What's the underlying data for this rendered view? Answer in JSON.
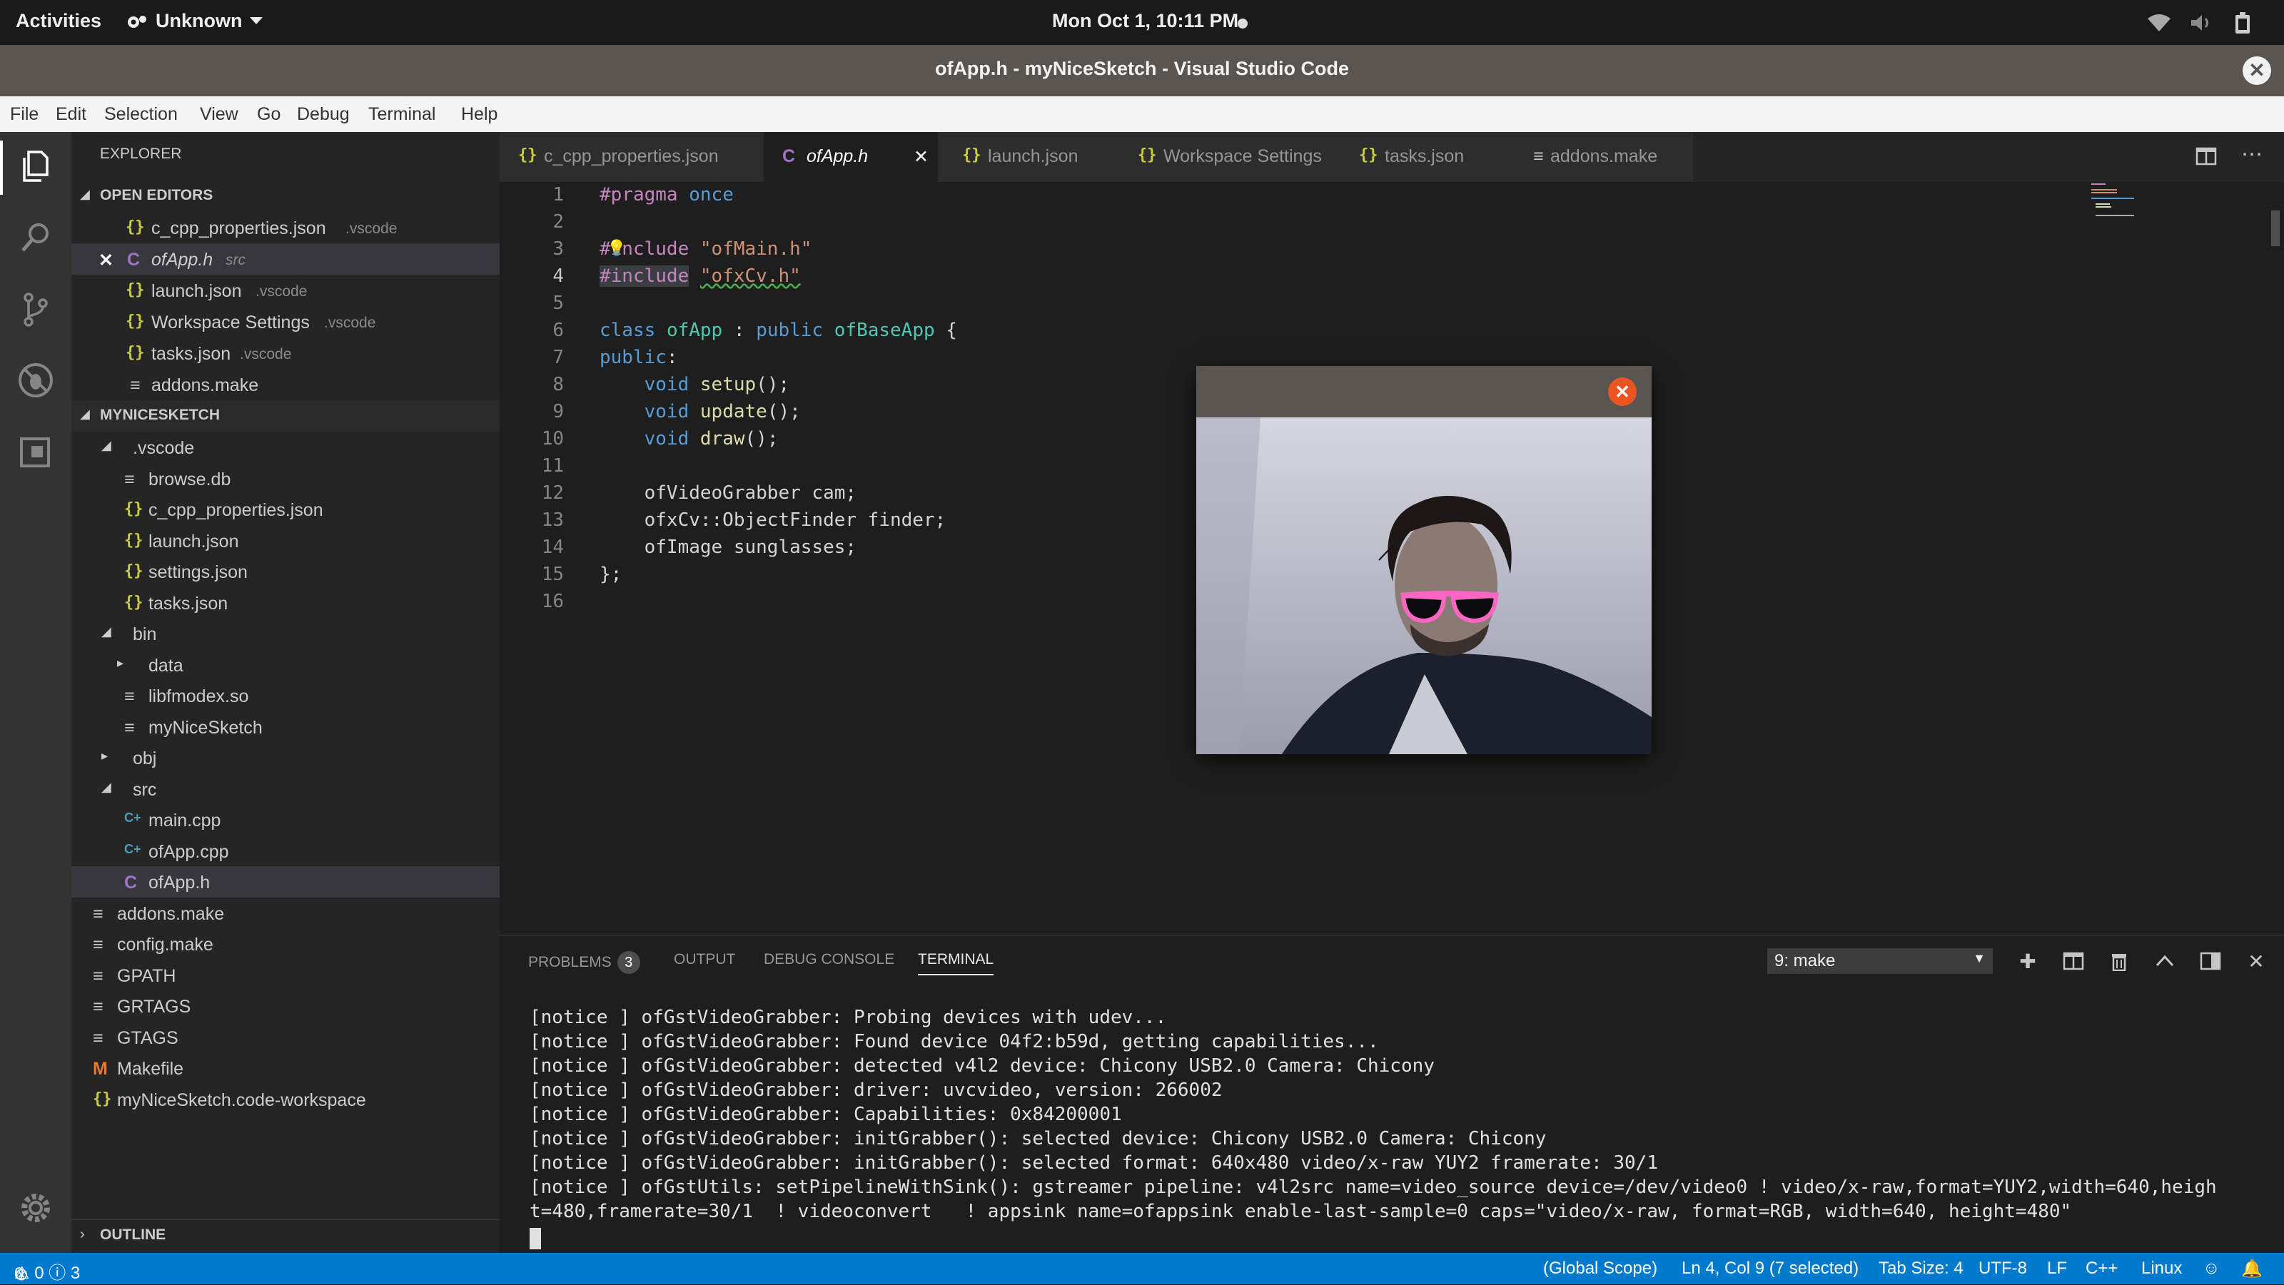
{
  "topbar": {
    "activities": "Activities",
    "app_menu": "Unknown",
    "clock": "Mon Oct  1, 10:11 PM"
  },
  "window": {
    "title": "ofApp.h - myNiceSketch - Visual Studio Code"
  },
  "menu": [
    "File",
    "Edit",
    "Selection",
    "View",
    "Go",
    "Debug",
    "Terminal",
    "Help"
  ],
  "explorer": {
    "header": "EXPLORER",
    "open_editors_header": "OPEN EDITORS",
    "open_editors": [
      {
        "name": "c_cpp_properties.json",
        "hint": ".vscode"
      },
      {
        "name": "ofApp.h",
        "hint": "src"
      },
      {
        "name": "launch.json",
        "hint": ".vscode"
      },
      {
        "name": "Workspace Settings",
        "hint": ".vscode"
      },
      {
        "name": "tasks.json",
        "hint": ".vscode"
      },
      {
        "name": "addons.make",
        "hint": ""
      }
    ],
    "project_header": "MYNICESKETCH",
    "tree": [
      ".vscode",
      "browse.db",
      "c_cpp_properties.json",
      "launch.json",
      "settings.json",
      "tasks.json",
      "bin",
      "data",
      "libfmodex.so",
      "myNiceSketch",
      "obj",
      "src",
      "main.cpp",
      "ofApp.cpp",
      "ofApp.h",
      "addons.make",
      "config.make",
      "GPATH",
      "GRTAGS",
      "GTAGS",
      "Makefile",
      "myNiceSketch.code-workspace"
    ],
    "outline_header": "OUTLINE"
  },
  "tabs": [
    "c_cpp_properties.json",
    "ofApp.h",
    "launch.json",
    "Workspace Settings",
    "tasks.json",
    "addons.make"
  ],
  "code_lines": [
    "1",
    "2",
    "3",
    "4",
    "5",
    "6",
    "7",
    "8",
    "9",
    "10",
    "11",
    "12",
    "13",
    "14",
    "15",
    "16"
  ],
  "panel": {
    "tabs": [
      "PROBLEMS",
      "OUTPUT",
      "DEBUG CONSOLE",
      "TERMINAL"
    ],
    "problems_count": "3",
    "terminal_select": "9: make",
    "terminal_lines": [
      "[notice ] ofGstVideoGrabber: Probing devices with udev...",
      "[notice ] ofGstVideoGrabber: Found device 04f2:b59d, getting capabilities...",
      "[notice ] ofGstVideoGrabber: detected v4l2 device: Chicony USB2.0 Camera: Chicony",
      "[notice ] ofGstVideoGrabber: driver: uvcvideo, version: 266002",
      "[notice ] ofGstVideoGrabber: Capabilities: 0x84200001",
      "[notice ] ofGstVideoGrabber: initGrabber(): selected device: Chicony USB2.0 Camera: Chicony",
      "[notice ] ofGstVideoGrabber: initGrabber(): selected format: 640x480 video/x-raw YUY2 framerate: 30/1",
      "[notice ] ofGstUtils: setPipelineWithSink(): gstreamer pipeline: v4l2src name=video_source device=/dev/video0 ! video/x-raw,format=YUY2,width=640,heigh",
      "t=480,framerate=30/1  ! videoconvert   ! appsink name=ofappsink enable-last-sample=0 caps=\"video/x-raw, format=RGB, width=640, height=480\""
    ]
  },
  "status": {
    "errors": "0",
    "warnings": "0",
    "infos": "3",
    "scope": "(Global Scope)",
    "position": "Ln 4, Col 9 (7 selected)",
    "tab_size": "Tab Size: 4",
    "encoding": "UTF-8",
    "eol": "LF",
    "language": "C++",
    "platform": "Linux"
  },
  "colors": {
    "accent": "#007acc",
    "ubuntu_orange": "#e95420",
    "sunglasses": "#ff66c4"
  }
}
